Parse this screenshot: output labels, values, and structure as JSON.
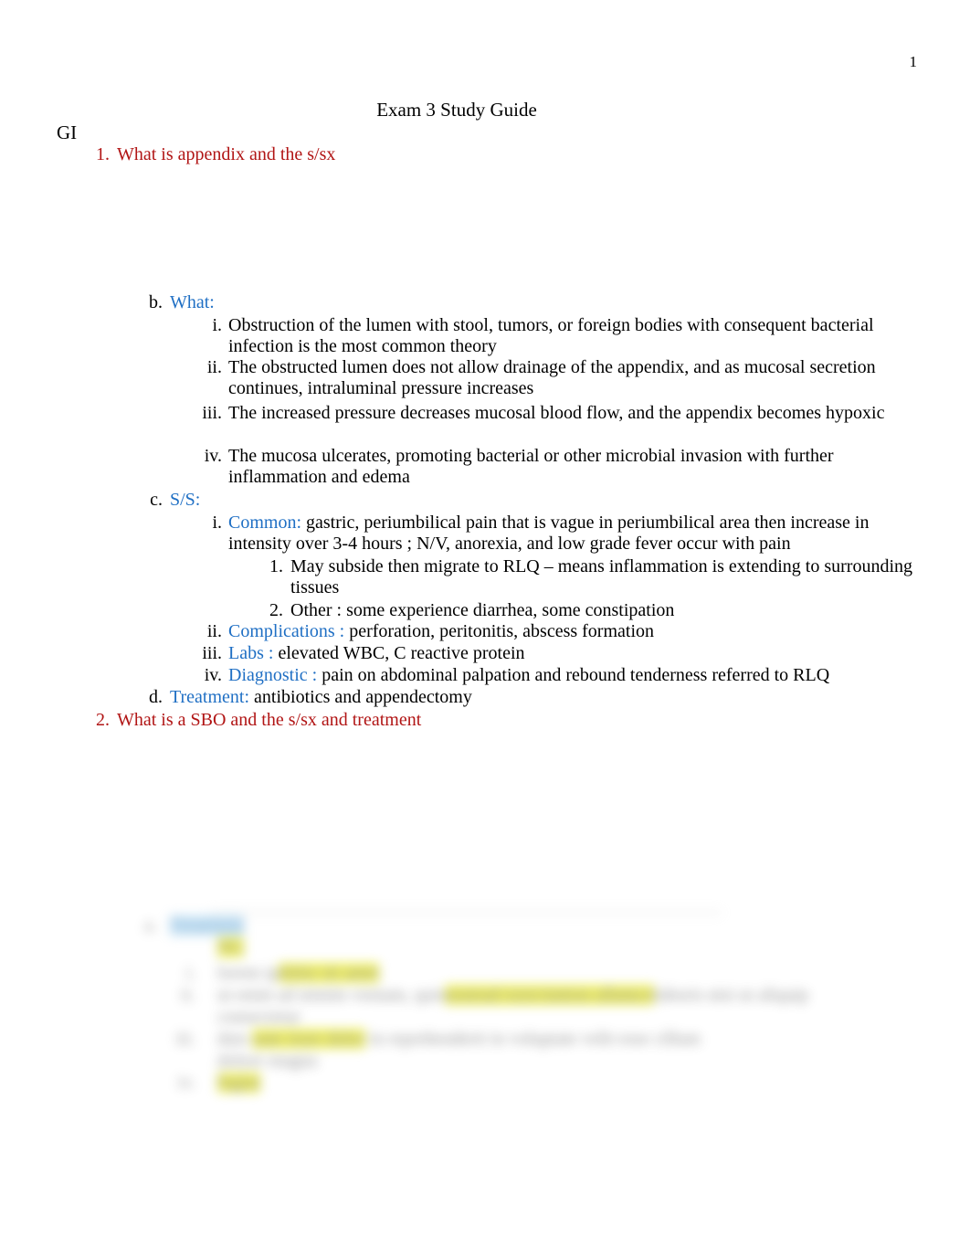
{
  "document": {
    "page_number": "1",
    "title": "Exam 3 Study Guide",
    "section": "GI"
  },
  "outline": {
    "q1": {
      "marker": "1.",
      "text": "What is appendix and the s/sx"
    },
    "what": {
      "marker": "b.",
      "label": "What:",
      "items": [
        {
          "marker": "i.",
          "text": "Obstruction of the lumen with stool, tumors, or foreign bodies with consequent bacterial infection is the most common theory"
        },
        {
          "marker": "ii.",
          "text": "The obstructed lumen   does not allow drainage of the appendix, and as mucosal secretion continues,  intraluminal pressure increases"
        },
        {
          "marker": "iii.",
          "text": "The increased pressure   decreases mucosal blood flow, and the appendix becomes hypoxic"
        },
        {
          "marker": "iv.",
          "text": "The mucosa ulcerates,   promoting bacterial or other microbial invasion with further inflammation and edema"
        }
      ]
    },
    "ss": {
      "marker": "c.",
      "label": "S/S:",
      "common": {
        "marker": "i.",
        "label": "Common:",
        "text": " gastric, periumbilical pain   that is vague  in periumbilical area then increase in  intensity over 3-4 hours  ; N/V, anorexia, and  low grade fever occur with pain",
        "subitems": [
          {
            "marker": "1.",
            "text": "May subside then migrate to    RLQ – means inflammation is extending to surrounding tissues"
          },
          {
            "marker": "2.",
            "text": "Other : some experience diarrhea, some constipation"
          }
        ]
      },
      "complications": {
        "marker": "ii.",
        "label": "Complications :",
        "text": " perforation, peritonitis, abscess formation"
      },
      "labs": {
        "marker": "iii.",
        "label": "Labs :",
        "text": " elevated WBC, C reactive protein"
      },
      "diagnostic": {
        "marker": "iv.",
        "label": "Diagnostic :",
        "text": " pain on abdominal palpation    and rebound tenderness referred to RLQ"
      }
    },
    "treatment": {
      "marker": "d.",
      "label": "Treatment:",
      "text": "   antibiotics and appendectomy"
    },
    "q2": {
      "marker": "2.",
      "text": "What is a SBO and the s/sx and treatment"
    }
  },
  "redacted_block": {
    "note": "blurred illegible content",
    "rows": [
      {
        "marker": "a.",
        "pre": "",
        "hl": "Treatment",
        "post": ""
      },
      {
        "marker": "",
        "pre": "",
        "hl": "NG",
        "post": ""
      },
      {
        "marker": "i.",
        "pre": "lorem ip",
        "hl": "dolor sit amet",
        "post": ""
      },
      {
        "marker": "ii.",
        "pre": "ut enim ad minim veniam, quis",
        "hl": "nostrud exercitation ullamco",
        "post": "laboris nisi ut aliquip"
      },
      {
        "marker": "iii.",
        "pre": "duis ",
        "hl": "aute irure dolor",
        "post": " in reprehenderit in voluptate velit esse cillum"
      },
      {
        "marker": "iv.",
        "pre": "",
        "hl": "fugiat",
        "post": ""
      }
    ]
  },
  "colors": {
    "heading_red": "#B11515",
    "label_blue": "#1F6FC4",
    "highlight_yellow": "#E8E80B",
    "highlight_blue": "#A8D4F0",
    "body_text": "#000000",
    "page_background": "#FFFFFF"
  }
}
